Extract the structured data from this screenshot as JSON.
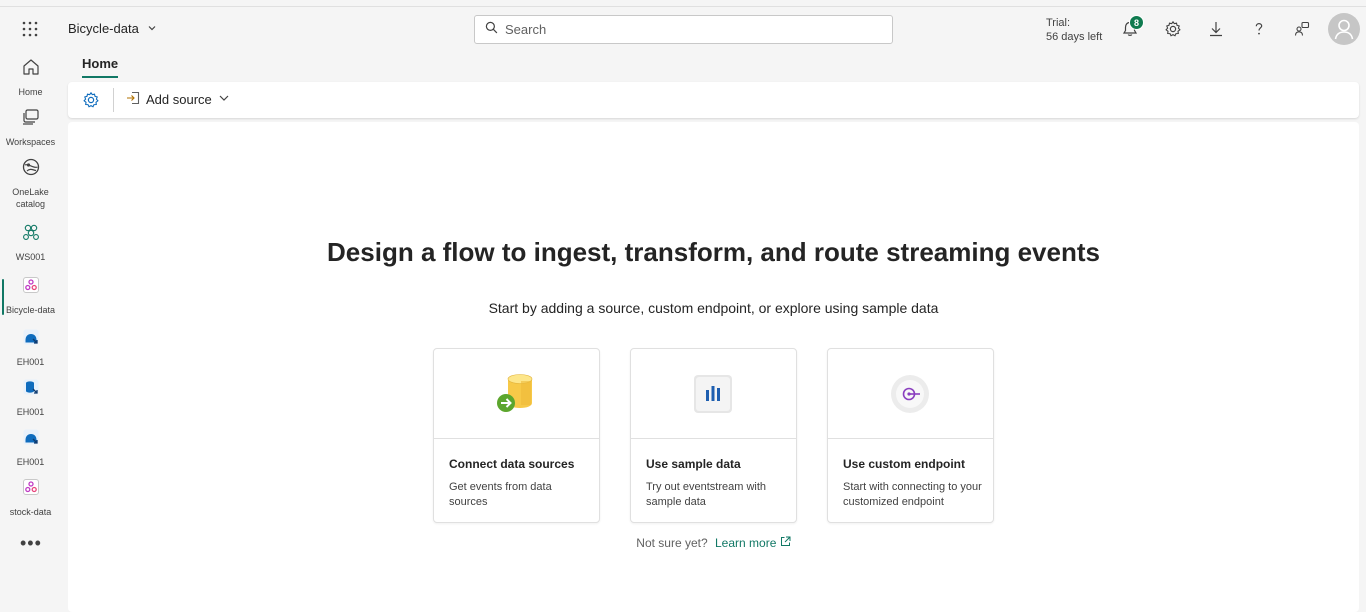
{
  "header": {
    "app_name": "Bicycle-data",
    "search_placeholder": "Search",
    "trial_line1": "Trial:",
    "trial_line2": "56 days left",
    "notification_count": "8"
  },
  "leftnav": {
    "items": [
      {
        "label": "Home",
        "icon": "home-icon"
      },
      {
        "label": "Workspaces",
        "icon": "workspaces-icon"
      },
      {
        "label": "OneLake\ncatalog",
        "icon": "onelake-icon"
      },
      {
        "label": "WS001",
        "icon": "workspace-icon"
      },
      {
        "label": "Bicycle-data",
        "icon": "eventstream-icon"
      },
      {
        "label": "EH001",
        "icon": "eventhouse-icon"
      },
      {
        "label": "EH001",
        "icon": "kql-database-icon"
      },
      {
        "label": "EH001",
        "icon": "eventhouse-icon"
      },
      {
        "label": "stock-data",
        "icon": "eventstream-icon"
      }
    ],
    "more": "•••"
  },
  "tabs": {
    "home": "Home"
  },
  "toolbar": {
    "add_source": "Add source"
  },
  "main": {
    "headline": "Design a flow to ingest, transform, and route streaming events",
    "subline": "Start by adding a source, custom endpoint, or explore using sample data",
    "cards": [
      {
        "title": "Connect data sources",
        "description": "Get events from data sources"
      },
      {
        "title": "Use sample data",
        "description": "Try out eventstream with sample data"
      },
      {
        "title": "Use custom endpoint",
        "description": "Start with connecting to your customized endpoint"
      }
    ],
    "not_sure": "Not sure yet?",
    "learn_more": "Learn more"
  },
  "colors": {
    "accent": "#117865",
    "badge": "#0f7b4f"
  }
}
